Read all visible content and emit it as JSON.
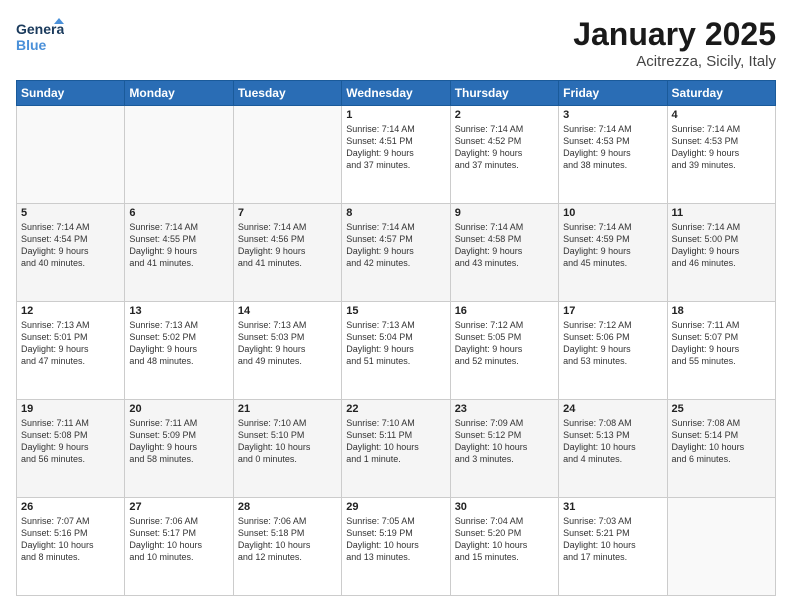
{
  "logo": {
    "line1": "General",
    "line2": "Blue"
  },
  "title": "January 2025",
  "location": "Acitrezza, Sicily, Italy",
  "days_header": [
    "Sunday",
    "Monday",
    "Tuesday",
    "Wednesday",
    "Thursday",
    "Friday",
    "Saturday"
  ],
  "weeks": [
    [
      {
        "num": "",
        "info": ""
      },
      {
        "num": "",
        "info": ""
      },
      {
        "num": "",
        "info": ""
      },
      {
        "num": "1",
        "info": "Sunrise: 7:14 AM\nSunset: 4:51 PM\nDaylight: 9 hours\nand 37 minutes."
      },
      {
        "num": "2",
        "info": "Sunrise: 7:14 AM\nSunset: 4:52 PM\nDaylight: 9 hours\nand 37 minutes."
      },
      {
        "num": "3",
        "info": "Sunrise: 7:14 AM\nSunset: 4:53 PM\nDaylight: 9 hours\nand 38 minutes."
      },
      {
        "num": "4",
        "info": "Sunrise: 7:14 AM\nSunset: 4:53 PM\nDaylight: 9 hours\nand 39 minutes."
      }
    ],
    [
      {
        "num": "5",
        "info": "Sunrise: 7:14 AM\nSunset: 4:54 PM\nDaylight: 9 hours\nand 40 minutes."
      },
      {
        "num": "6",
        "info": "Sunrise: 7:14 AM\nSunset: 4:55 PM\nDaylight: 9 hours\nand 41 minutes."
      },
      {
        "num": "7",
        "info": "Sunrise: 7:14 AM\nSunset: 4:56 PM\nDaylight: 9 hours\nand 41 minutes."
      },
      {
        "num": "8",
        "info": "Sunrise: 7:14 AM\nSunset: 4:57 PM\nDaylight: 9 hours\nand 42 minutes."
      },
      {
        "num": "9",
        "info": "Sunrise: 7:14 AM\nSunset: 4:58 PM\nDaylight: 9 hours\nand 43 minutes."
      },
      {
        "num": "10",
        "info": "Sunrise: 7:14 AM\nSunset: 4:59 PM\nDaylight: 9 hours\nand 45 minutes."
      },
      {
        "num": "11",
        "info": "Sunrise: 7:14 AM\nSunset: 5:00 PM\nDaylight: 9 hours\nand 46 minutes."
      }
    ],
    [
      {
        "num": "12",
        "info": "Sunrise: 7:13 AM\nSunset: 5:01 PM\nDaylight: 9 hours\nand 47 minutes."
      },
      {
        "num": "13",
        "info": "Sunrise: 7:13 AM\nSunset: 5:02 PM\nDaylight: 9 hours\nand 48 minutes."
      },
      {
        "num": "14",
        "info": "Sunrise: 7:13 AM\nSunset: 5:03 PM\nDaylight: 9 hours\nand 49 minutes."
      },
      {
        "num": "15",
        "info": "Sunrise: 7:13 AM\nSunset: 5:04 PM\nDaylight: 9 hours\nand 51 minutes."
      },
      {
        "num": "16",
        "info": "Sunrise: 7:12 AM\nSunset: 5:05 PM\nDaylight: 9 hours\nand 52 minutes."
      },
      {
        "num": "17",
        "info": "Sunrise: 7:12 AM\nSunset: 5:06 PM\nDaylight: 9 hours\nand 53 minutes."
      },
      {
        "num": "18",
        "info": "Sunrise: 7:11 AM\nSunset: 5:07 PM\nDaylight: 9 hours\nand 55 minutes."
      }
    ],
    [
      {
        "num": "19",
        "info": "Sunrise: 7:11 AM\nSunset: 5:08 PM\nDaylight: 9 hours\nand 56 minutes."
      },
      {
        "num": "20",
        "info": "Sunrise: 7:11 AM\nSunset: 5:09 PM\nDaylight: 9 hours\nand 58 minutes."
      },
      {
        "num": "21",
        "info": "Sunrise: 7:10 AM\nSunset: 5:10 PM\nDaylight: 10 hours\nand 0 minutes."
      },
      {
        "num": "22",
        "info": "Sunrise: 7:10 AM\nSunset: 5:11 PM\nDaylight: 10 hours\nand 1 minute."
      },
      {
        "num": "23",
        "info": "Sunrise: 7:09 AM\nSunset: 5:12 PM\nDaylight: 10 hours\nand 3 minutes."
      },
      {
        "num": "24",
        "info": "Sunrise: 7:08 AM\nSunset: 5:13 PM\nDaylight: 10 hours\nand 4 minutes."
      },
      {
        "num": "25",
        "info": "Sunrise: 7:08 AM\nSunset: 5:14 PM\nDaylight: 10 hours\nand 6 minutes."
      }
    ],
    [
      {
        "num": "26",
        "info": "Sunrise: 7:07 AM\nSunset: 5:16 PM\nDaylight: 10 hours\nand 8 minutes."
      },
      {
        "num": "27",
        "info": "Sunrise: 7:06 AM\nSunset: 5:17 PM\nDaylight: 10 hours\nand 10 minutes."
      },
      {
        "num": "28",
        "info": "Sunrise: 7:06 AM\nSunset: 5:18 PM\nDaylight: 10 hours\nand 12 minutes."
      },
      {
        "num": "29",
        "info": "Sunrise: 7:05 AM\nSunset: 5:19 PM\nDaylight: 10 hours\nand 13 minutes."
      },
      {
        "num": "30",
        "info": "Sunrise: 7:04 AM\nSunset: 5:20 PM\nDaylight: 10 hours\nand 15 minutes."
      },
      {
        "num": "31",
        "info": "Sunrise: 7:03 AM\nSunset: 5:21 PM\nDaylight: 10 hours\nand 17 minutes."
      },
      {
        "num": "",
        "info": ""
      }
    ]
  ]
}
